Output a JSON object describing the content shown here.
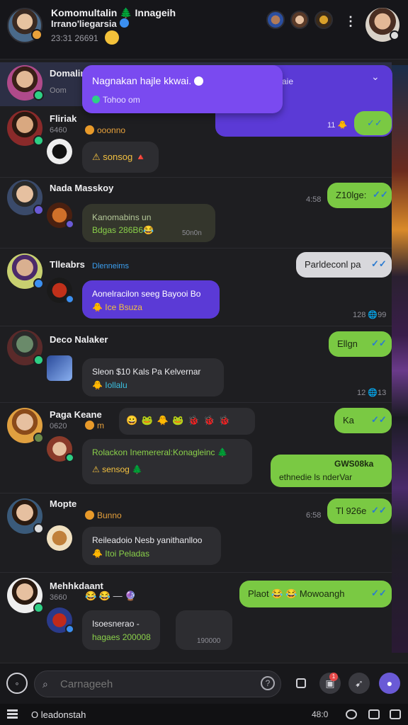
{
  "header": {
    "title": "Komomultalin 🌲 Innageih",
    "subtitle": "Irrano'liegarsia",
    "meta": "23:31 26691",
    "more_glyph": "⋮"
  },
  "popup": {
    "title": "Nagnakan hajle kkwai.",
    "title_icon": "verified-icon",
    "subtitle": "Tohoo om",
    "underlay_text": "aie",
    "underlay_time": "11 🐥"
  },
  "rows": [
    {
      "name": "Domalin",
      "meta": "Oom",
      "selected": true
    },
    {
      "name": "Fliriak",
      "meta": "6460",
      "tag": "ooonno",
      "bubble": "⚠ sonsog 🔺"
    },
    {
      "name": "Nada Masskoy",
      "meta": "",
      "bubble_line1": "Kanomabins un",
      "bubble_line2": "Bdgas 286B6😂",
      "bubble_time": "50n0n",
      "out_text": "Z10lge:",
      "out_time": "4:58"
    },
    {
      "name": "Tlleabrs",
      "meta_tag": "Dlenneims",
      "bubble_line1": "Aonelracilon seeg Bayooi Bo",
      "bubble_line2": "🐥 Ice Bsuza",
      "out_text": "Parldeconl pa",
      "out_time": "128 🌐99"
    },
    {
      "name": "Deco Nalaker",
      "bubble_line1": "Sleon $10 Kals Pa Kelvernar",
      "bubble_line2": "🐥 Iollalu",
      "out_text": "Ellgn",
      "out_time": "12 🌐13"
    },
    {
      "name": "Paga Keane",
      "meta": "0620",
      "tag": "m",
      "emoji_row": "😀 🐸 🐥 🐸 🐞 🐞 🐞",
      "bubble_line1": "Rolackon Inemereral:Konagleinc 🌲",
      "bubble_line2": "⚠ sensog 🌲",
      "out_text": "Ka",
      "out2_line1": "GWS08ka",
      "out2_line2": "ethnedie ls nderVar"
    },
    {
      "name": "Mopte",
      "tag": "Bunno",
      "bubble_line1": "Reileadoio Nesb yanithanlloo",
      "bubble_line2": "🐥 Itoi Peladas",
      "out_text": "Tl 926e",
      "out_time": "6:58"
    },
    {
      "name": "Mehhkdaant",
      "meta": "3660",
      "emoji_row": "😂 😂 — 🔮",
      "bubble_line1": "Isoesnerao -",
      "bubble_line2": "hagaes 200008",
      "bubble2_text": "190000",
      "out_text": "Plaot 😂 😂 Mowoangh"
    }
  ],
  "composer": {
    "placeholder": "Carnageeh",
    "notification_count": "1"
  },
  "statusbar": {
    "label": "O leadonstah",
    "right": "48:0"
  }
}
